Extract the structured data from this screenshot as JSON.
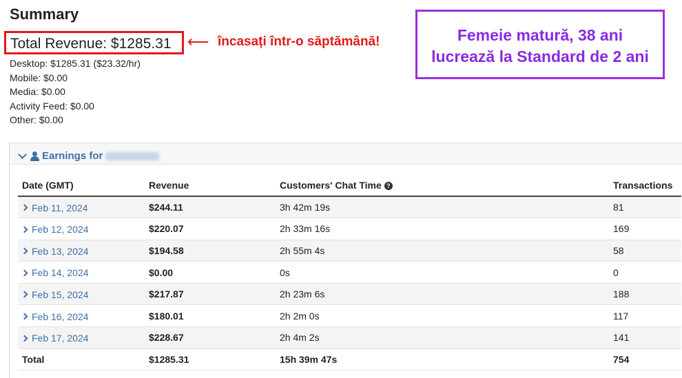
{
  "summary": {
    "title": "Summary",
    "total_revenue": "Total Revenue: $1285.31",
    "breakdown": [
      "Desktop: $1285.31 ($23.32/hr)",
      "Mobile: $0.00",
      "Media: $0.00",
      "Activity Feed: $0.00",
      "Other: $0.00"
    ]
  },
  "annotations": {
    "arrow": "⟵",
    "red_text": "încasați într-o săptămână!",
    "purple_line1": "Femeie matură, 38 ani",
    "purple_line2": "lucrează la Standard de 2 ani",
    "red_color": "#e21a1a",
    "purple_color": "#8a2be2"
  },
  "earnings": {
    "header_label": "Earnings for",
    "accent_color": "#3d6fa8",
    "columns": {
      "date": "Date (GMT)",
      "revenue": "Revenue",
      "chat_time": "Customers' Chat Time",
      "transactions": "Transactions"
    },
    "rows": [
      {
        "date": "Feb 11, 2024",
        "revenue": "$244.11",
        "chat_time": "3h 42m 19s",
        "transactions": "81"
      },
      {
        "date": "Feb 12, 2024",
        "revenue": "$220.07",
        "chat_time": "2h 33m 16s",
        "transactions": "169"
      },
      {
        "date": "Feb 13, 2024",
        "revenue": "$194.58",
        "chat_time": "2h 55m 4s",
        "transactions": "58"
      },
      {
        "date": "Feb 14, 2024",
        "revenue": "$0.00",
        "chat_time": "0s",
        "transactions": "0"
      },
      {
        "date": "Feb 15, 2024",
        "revenue": "$217.87",
        "chat_time": "2h 23m 6s",
        "transactions": "188"
      },
      {
        "date": "Feb 16, 2024",
        "revenue": "$180.01",
        "chat_time": "2h 2m 0s",
        "transactions": "117"
      },
      {
        "date": "Feb 17, 2024",
        "revenue": "$228.67",
        "chat_time": "2h 4m 2s",
        "transactions": "141"
      }
    ],
    "total": {
      "label": "Total",
      "revenue": "$1285.31",
      "chat_time": "15h 39m 47s",
      "transactions": "754"
    }
  }
}
